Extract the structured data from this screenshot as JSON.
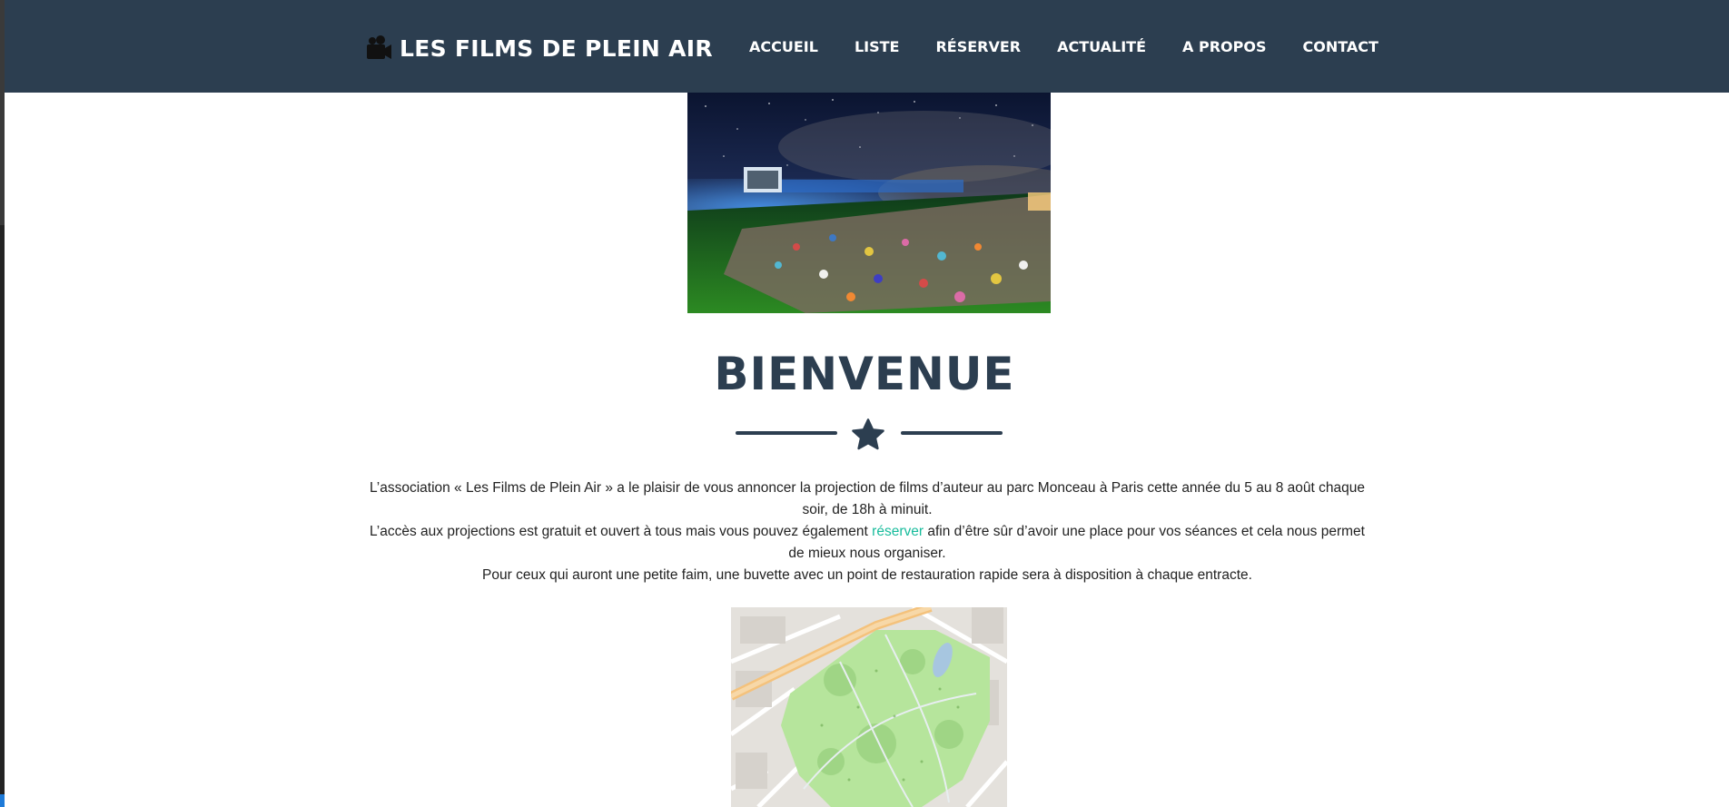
{
  "site": {
    "brand": "LES FILMS DE PLEIN AIR",
    "brand_icon": "video-camera-icon",
    "colors": {
      "navbar": "#2c3e50",
      "accent_link": "#18bc9c",
      "title": "#2c3e50"
    }
  },
  "nav": {
    "items": [
      {
        "label": "ACCUEIL"
      },
      {
        "label": "LISTE"
      },
      {
        "label": "RÉSERVER"
      },
      {
        "label": "ACTUALITÉ"
      },
      {
        "label": "A PROPOS"
      },
      {
        "label": "CONTACT"
      }
    ]
  },
  "main": {
    "title": "BIENVENUE",
    "divider_icon": "star-icon",
    "paragraph1": "L’association « Les Films de Plein Air » a le plaisir de vous annoncer la projection de films d’auteur au parc Monceau à Paris cette année du 5 au 8 août chaque soir, de 18h à minuit.",
    "paragraph2_before": "L’accès aux projections est gratuit et ouvert à tous mais vous pouvez également ",
    "paragraph2_link": "réserver",
    "paragraph2_after": " afin d’être sûr d’avoir une place pour vos séances et cela nous permet de mieux nous organiser.",
    "paragraph3": "Pour ceux qui auront une petite faim, une buvette avec un point de restauration rapide sera à disposition à chaque entracte."
  }
}
